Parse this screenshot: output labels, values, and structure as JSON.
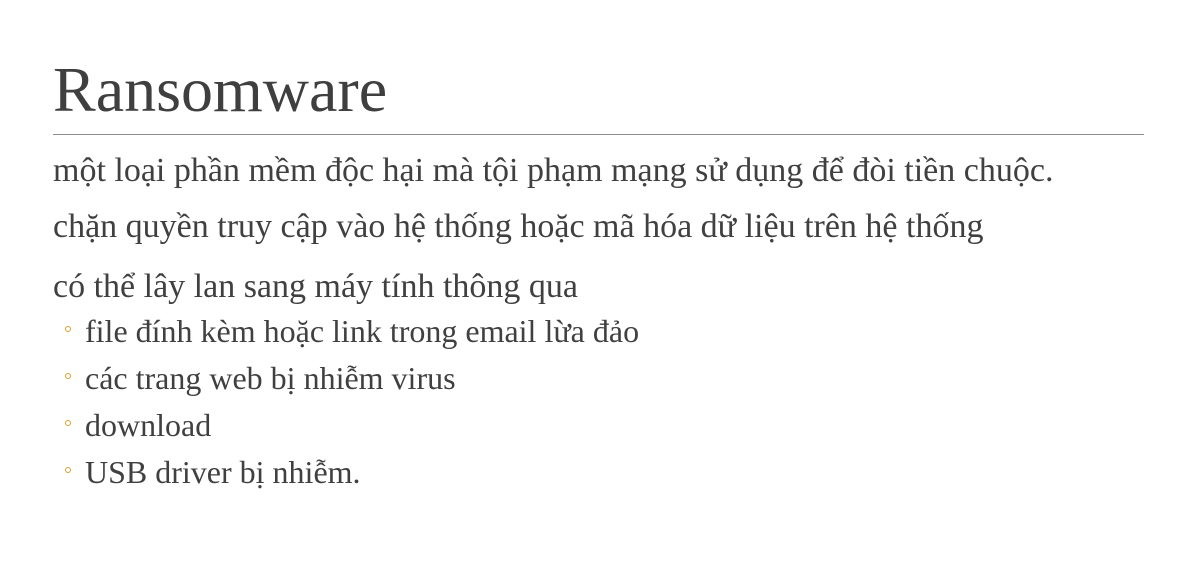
{
  "slide": {
    "title": "Ransomware",
    "paragraphs": [
      "một loại phần mềm độc hại mà tội phạm mạng sử dụng để đòi tiền chuộc.",
      "chặn quyền truy cập vào hệ thống hoặc mã hóa dữ liệu trên hệ thống",
      "có thể lây lan sang máy tính thông qua"
    ],
    "sub_items": [
      "file đính kèm hoặc link trong email lừa đảo",
      "các trang web bị nhiễm virus",
      "download",
      "USB driver bị nhiễm."
    ]
  },
  "colors": {
    "text": "#404040",
    "title": "#3f3f3f",
    "rule": "#8c8c8c",
    "bullet_accent": "#e59c2c",
    "background": "#ffffff"
  },
  "icons": {
    "sub_bullet": "hollow-circle-bullet-icon"
  }
}
